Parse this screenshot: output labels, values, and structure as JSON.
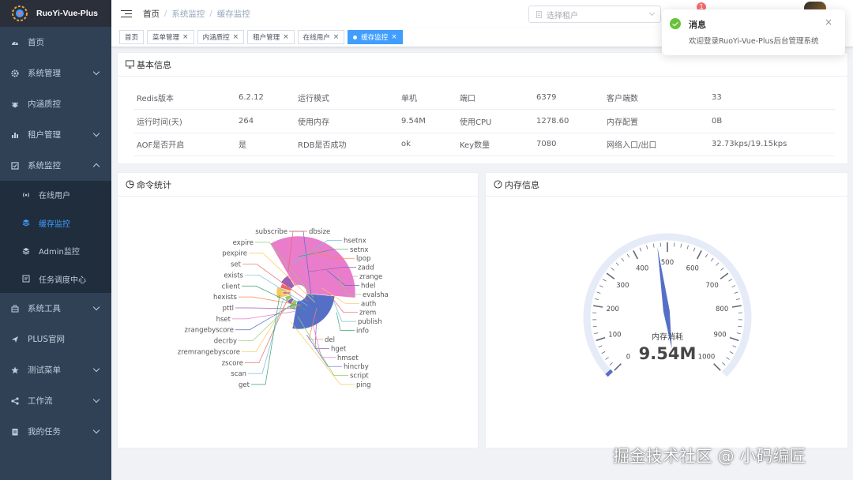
{
  "app": {
    "title": "RuoYi-Vue-Plus"
  },
  "sidebar": {
    "items": [
      {
        "label": "首页",
        "icon": "dashboard-icon",
        "arrow": false
      },
      {
        "label": "系统管理",
        "icon": "gear-icon",
        "arrow": true
      },
      {
        "label": "内涵质控",
        "icon": "bug-icon",
        "arrow": false
      },
      {
        "label": "租户管理",
        "icon": "chart-icon",
        "arrow": true
      },
      {
        "label": "系统监控",
        "icon": "monitor-icon",
        "arrow": true,
        "expanded": true
      }
    ],
    "monitor_children": [
      {
        "label": "在线用户",
        "icon": "online-icon",
        "active": false
      },
      {
        "label": "缓存监控",
        "icon": "redis-icon",
        "active": true
      },
      {
        "label": "Admin监控",
        "icon": "server-icon",
        "active": false
      },
      {
        "label": "任务调度中心",
        "icon": "job-icon",
        "active": false
      }
    ],
    "items_after": [
      {
        "label": "系统工具",
        "icon": "toolbox-icon",
        "arrow": true
      },
      {
        "label": "PLUS官网",
        "icon": "send-icon",
        "arrow": false
      },
      {
        "label": "测试菜单",
        "icon": "star-icon",
        "arrow": true
      },
      {
        "label": "工作流",
        "icon": "share-icon",
        "arrow": true
      },
      {
        "label": "我的任务",
        "icon": "task-icon",
        "arrow": true
      }
    ]
  },
  "breadcrumb": [
    "首页",
    "系统监控",
    "缓存监控"
  ],
  "breadcrumb_sep": "/",
  "header": {
    "tenant_placeholder": "选择租户",
    "notice_count": "1"
  },
  "tags": [
    {
      "label": "首页",
      "closable": false,
      "active": false
    },
    {
      "label": "菜单管理",
      "closable": true,
      "active": false
    },
    {
      "label": "内涵质控",
      "closable": true,
      "active": false
    },
    {
      "label": "租户管理",
      "closable": true,
      "active": false
    },
    {
      "label": "在线用户",
      "closable": true,
      "active": false
    },
    {
      "label": "缓存监控",
      "closable": true,
      "active": true
    }
  ],
  "tag_close_symbol": "×",
  "basic_info": {
    "title": "基本信息",
    "rows": [
      [
        "Redis版本",
        "6.2.12",
        "运行模式",
        "单机",
        "端口",
        "6379",
        "客户端数",
        "33"
      ],
      [
        "运行时间(天)",
        "264",
        "使用内存",
        "9.54M",
        "使用CPU",
        "1278.60",
        "内存配置",
        "0B"
      ],
      [
        "AOF是否开启",
        "是",
        "RDB是否成功",
        "ok",
        "Key数量",
        "7080",
        "网络入口/出口",
        "32.73kps/19.15kps"
      ]
    ]
  },
  "command_stats": {
    "title": "命令统计",
    "labels_left": [
      "subscribe",
      "expire",
      "pexpire",
      "set",
      "exists",
      "client",
      "hexists",
      "pttl",
      "hset",
      "zrangebyscore",
      "decrby",
      "zremrangebyscore",
      "zscore",
      "scan",
      "get"
    ],
    "labels_right": [
      "dbsize",
      "hsetnx",
      "setnx",
      "lpop",
      "zadd",
      "zrange",
      "hdel",
      "evalsha",
      "auth",
      "zrem",
      "publish",
      "info",
      "del",
      "hget",
      "hmset",
      "hincrby",
      "script",
      "ping"
    ]
  },
  "memory_info": {
    "title": "内存信息",
    "gauge_label": "内存消耗",
    "gauge_value_text": "9.54M",
    "gauge_value": 9.54,
    "gauge_min": 0,
    "gauge_max": 1000,
    "ticks": [
      "0",
      "100",
      "200",
      "300",
      "400",
      "500",
      "600",
      "700",
      "800",
      "900",
      "1000"
    ]
  },
  "notification": {
    "title": "消息",
    "message": "欢迎登录RuoYi-Vue-Plus后台管理系统",
    "close_symbol": "×"
  },
  "watermark": "掘金技术社区 @ 小码编匠",
  "colors": {
    "sidebar_bg": "#304156",
    "active": "#409eff",
    "gauge_pointer": "#5470c6"
  }
}
